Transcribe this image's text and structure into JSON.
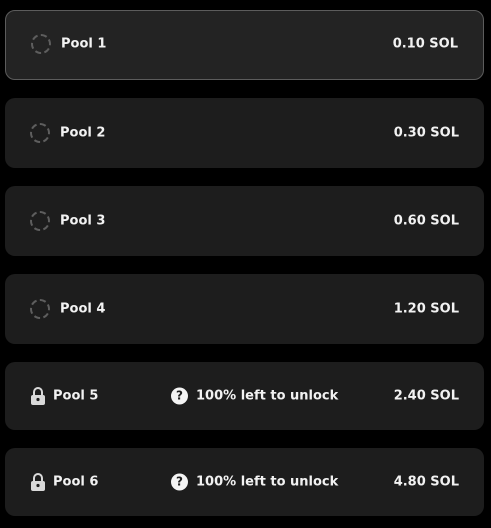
{
  "pools": [
    {
      "name": "Pool 1",
      "amount": "0.10 SOL",
      "status_icon": "spinner-icon",
      "selected": true
    },
    {
      "name": "Pool 2",
      "amount": "0.30 SOL",
      "status_icon": "spinner-icon"
    },
    {
      "name": "Pool 3",
      "amount": "0.60 SOL",
      "status_icon": "spinner-icon"
    },
    {
      "name": "Pool 4",
      "amount": "1.20 SOL",
      "status_icon": "spinner-icon"
    },
    {
      "name": "Pool 5",
      "amount": "2.40 SOL",
      "status_icon": "lock-icon",
      "unlock_text": "100% left to unlock",
      "info_icon": "question-icon",
      "info_glyph": "?"
    },
    {
      "name": "Pool 6",
      "amount": "4.80 SOL",
      "status_icon": "lock-icon",
      "unlock_text": "100% left to unlock",
      "info_icon": "question-icon",
      "info_glyph": "?"
    }
  ],
  "colors": {
    "page_background": "#000000",
    "row_background": "#1d1d1d",
    "selected_border": "#5c5c5c",
    "text": "#f2f2f2",
    "spinner": "#5e5e5e"
  }
}
